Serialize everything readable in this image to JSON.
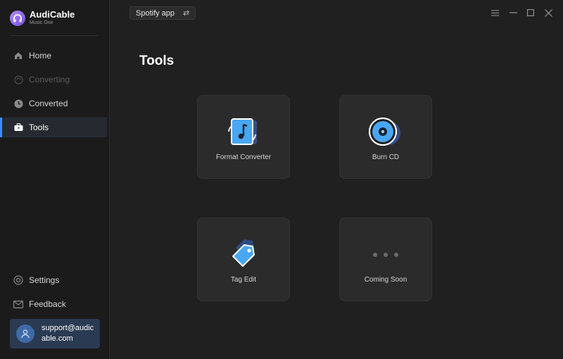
{
  "brand": {
    "name": "AudiCable",
    "subtitle": "Music One"
  },
  "sidebar": {
    "items": [
      {
        "label": "Home",
        "state": "normal",
        "icon": "home-icon"
      },
      {
        "label": "Converting",
        "state": "disabled",
        "icon": "converting-icon"
      },
      {
        "label": "Converted",
        "state": "normal",
        "icon": "clock-icon"
      },
      {
        "label": "Tools",
        "state": "active",
        "icon": "toolbox-icon"
      }
    ],
    "bottom_items": [
      {
        "label": "Settings",
        "icon": "gear-icon"
      },
      {
        "label": "Feedback",
        "icon": "mail-icon"
      }
    ],
    "user": {
      "email": "support@audicable.com"
    }
  },
  "topbar": {
    "source_label": "Spotify app",
    "swap_icon": "swap-icon"
  },
  "main": {
    "title": "Tools",
    "tools": [
      {
        "label": "Format Converter",
        "icon": "format-converter-icon"
      },
      {
        "label": "Burn CD",
        "icon": "cd-icon"
      },
      {
        "label": "Tag Edit",
        "icon": "tag-icon"
      },
      {
        "label": "Coming Soon",
        "icon": "more-dots-icon"
      }
    ]
  },
  "colors": {
    "accent": "#3d8bff",
    "background": "#202020",
    "sidebar": "#1b1b1b",
    "card": "#2b2b2b",
    "user_card": "#2a3a52"
  }
}
